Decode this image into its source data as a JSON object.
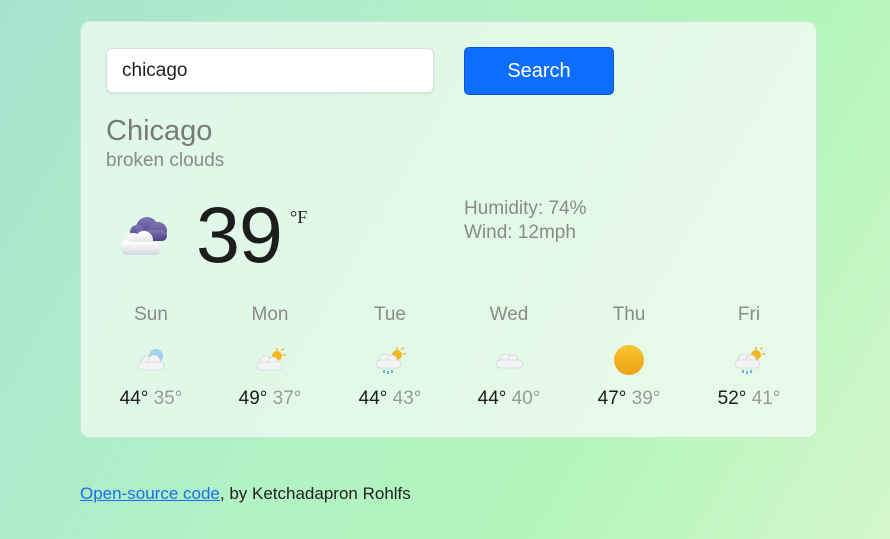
{
  "search": {
    "value": "chicago",
    "button_label": "Search"
  },
  "current": {
    "city": "Chicago",
    "condition": "broken clouds",
    "icon": "broken-clouds-icon",
    "temperature": "39",
    "unit": "°F",
    "humidity": "Humidity: 74%",
    "wind": "Wind: 12mph"
  },
  "forecast": [
    {
      "day": "Sun",
      "high": "44°",
      "low": "35°",
      "icon": "cloud-sun-icon"
    },
    {
      "day": "Mon",
      "high": "49°",
      "low": "37°",
      "icon": "cloud-sun-icon"
    },
    {
      "day": "Tue",
      "high": "44°",
      "low": "43°",
      "icon": "rain-sun-icon"
    },
    {
      "day": "Wed",
      "high": "44°",
      "low": "40°",
      "icon": "cloud-icon"
    },
    {
      "day": "Thu",
      "high": "47°",
      "low": "39°",
      "icon": "sun-icon"
    },
    {
      "day": "Fri",
      "high": "52°",
      "low": "41°",
      "icon": "rain-sun-icon"
    }
  ],
  "footer": {
    "link_text": "Open-source code",
    "text": ", by Ketchadapron Rohlfs"
  }
}
